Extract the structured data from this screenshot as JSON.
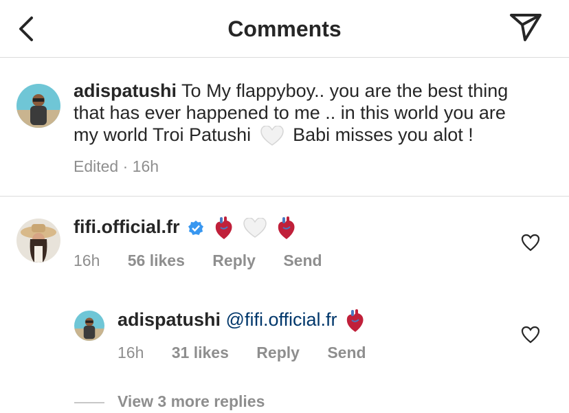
{
  "header": {
    "title": "Comments"
  },
  "caption": {
    "username": "adispatushi",
    "text_1": "To My flappyboy.. you are the best thing",
    "text_2": "that has ever happened to me .. in this world you are",
    "text_3": "my world Troi Patushi",
    "text_4": "Babi misses you alot !",
    "meta": "Edited · 16h"
  },
  "comment": {
    "username": "fifi.official.fr",
    "time": "16h",
    "likes": "56 likes",
    "reply": "Reply",
    "send": "Send"
  },
  "reply": {
    "username": "adispatushi",
    "mention": "@fifi.official.fr",
    "time": "16h",
    "likes": "31 likes",
    "reply": "Reply",
    "send": "Send"
  },
  "view_more": "View 3 more replies"
}
